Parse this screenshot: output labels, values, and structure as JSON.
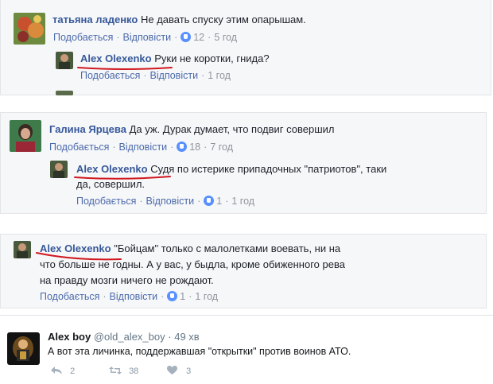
{
  "c1": {
    "author": "татьяна ладенко",
    "text": "Не давать спуску этим опарышам.",
    "like": "Подобається",
    "reply": "Відповісти",
    "likes": "12",
    "time": "5 год"
  },
  "c1r": {
    "author": "Alex Olexenko",
    "text": "Руки не коротки, гнида?",
    "like": "Подобається",
    "reply": "Відповісти",
    "time": "1 год"
  },
  "c2": {
    "author": "Галина Ярцева",
    "text": "Да уж. Дурак думает, что подвиг совершил",
    "like": "Подобається",
    "reply": "Відповісти",
    "likes": "18",
    "time": "7 год"
  },
  "c2r": {
    "author": "Alex Olexenko",
    "text1": "Судя по истерике припадочных \"патриотов\", таки",
    "text2": "да, совершил.",
    "like": "Подобається",
    "reply": "Відповісти",
    "likes": "1",
    "time": "1 год"
  },
  "c3": {
    "author": "Alex Olexenko",
    "text1": "\"Бойцам\" только с малолетками воевать, ни на",
    "text2": "что больше не годны. А у вас, у быдла, кроме обиженного рева",
    "text3": "на правду мозги ничего не рождают.",
    "like": "Подобається",
    "reply": "Відповісти",
    "likes": "1",
    "time": "1 год"
  },
  "tweet": {
    "name": "Alex boy",
    "handle": "@old_alex_boy",
    "dot": "·",
    "time": "49 хв",
    "text": "А вот эта личинка, поддержавшая \"открытки\" против воинов АТО.",
    "replies": "2",
    "retweets": "38",
    "likes": "3"
  },
  "colors": {
    "link": "#365899",
    "action": "#4b6aab",
    "meta": "#90949c",
    "like": "#5890ff",
    "underline": "#d0181f"
  },
  "icons": [
    "reply-arrow-icon",
    "retweet-icon",
    "heart-icon",
    "like-badge-icon"
  ]
}
